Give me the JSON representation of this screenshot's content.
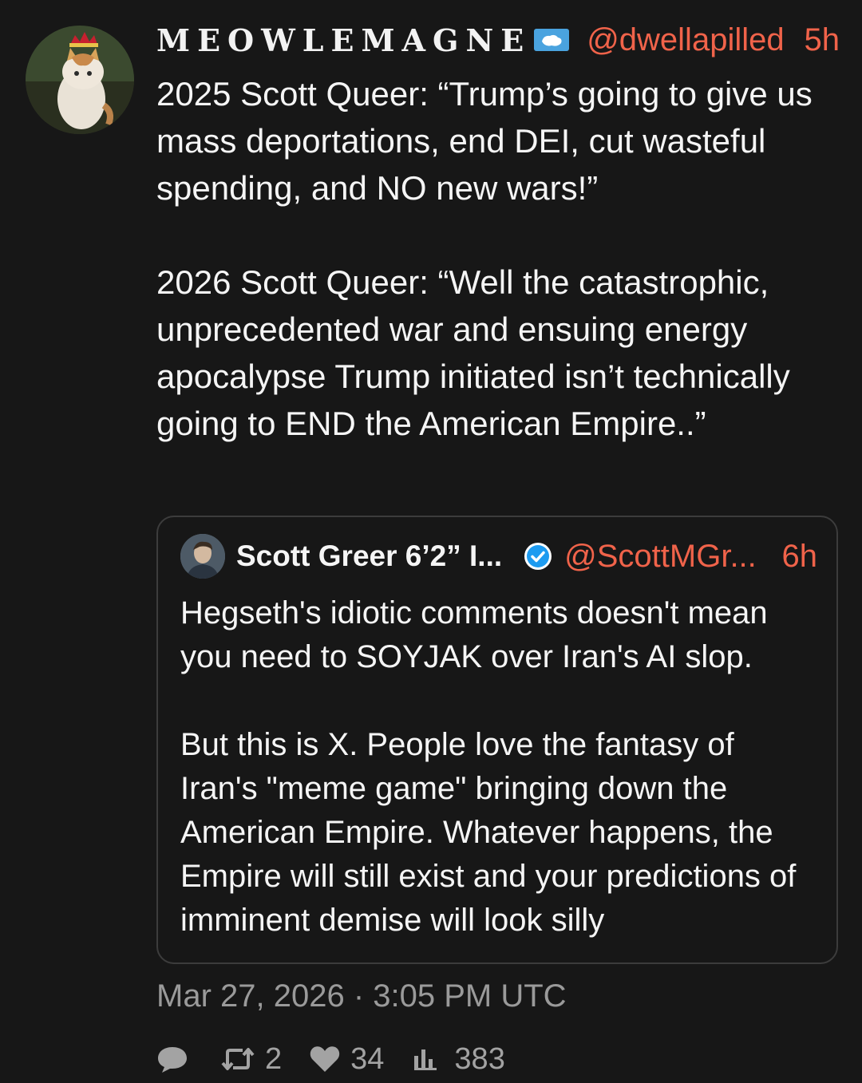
{
  "colors": {
    "background": "#171717",
    "accent": "#f0634a",
    "muted": "#9a9a9a",
    "verified": "#1d9bf0"
  },
  "tweet": {
    "display_name": "MEOWLEMAGNE",
    "flag_icon": "antarctica-flag-icon",
    "handle": "@dwellapilled",
    "time": "5h",
    "paragraphs": [
      "2025 Scott Queer: “Trump’s going to give us mass deportations, end DEI, cut wasteful spending, and NO new wars!”",
      "2026 Scott Queer: “Well the catastrophic, unprecedented war and ensuing energy apocalypse Trump initiated isn’t technically going to END the American Empire..”"
    ],
    "date": "Mar 27, 2026 · 3:05 PM UTC"
  },
  "quote": {
    "display_name": "Scott Greer 6’2” I...",
    "verified_icon": "verified-badge-icon",
    "handle": "@ScottMGr...",
    "time": "6h",
    "paragraphs": [
      "Hegseth's idiotic comments doesn't mean you need to SOYJAK over Iran's AI slop.",
      "But this is X. People love the fantasy of Iran's \"meme game\" bringing down the American Empire. Whatever happens, the Empire will still exist and your predictions of imminent demise will look silly"
    ]
  },
  "stats": {
    "replies": "",
    "retweets": "2",
    "likes": "34",
    "views": "383"
  }
}
